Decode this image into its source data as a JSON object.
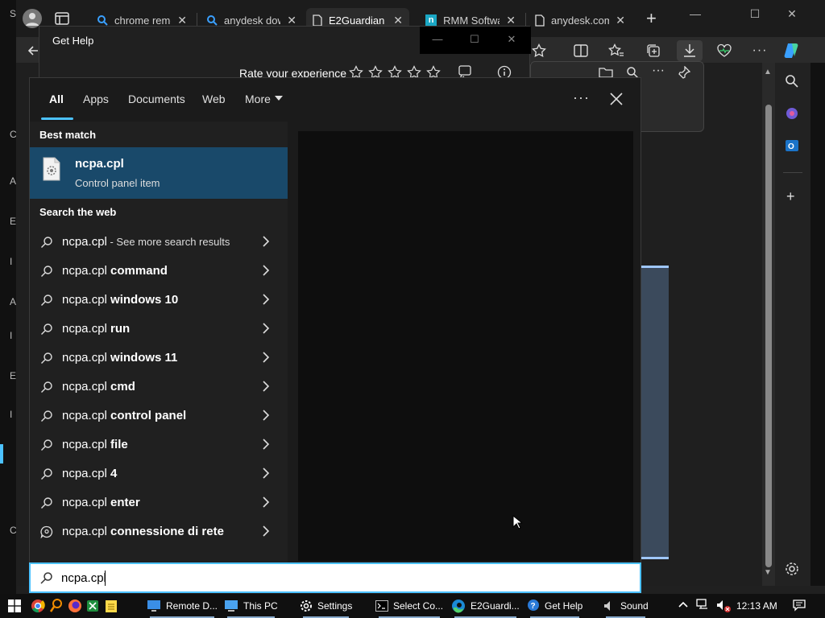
{
  "browser": {
    "tabs": [
      {
        "label": "chrome remo",
        "icon": "search-icon"
      },
      {
        "label": "anydesk dow",
        "icon": "search-icon"
      },
      {
        "label": "E2Guardian -",
        "icon": "page-icon"
      },
      {
        "label": "RMM Softwa",
        "icon": "ninja-icon"
      },
      {
        "label": "anydesk.com",
        "icon": "page-icon"
      }
    ],
    "new_tab": "+",
    "toolbar_icons": [
      "favorite-star-icon",
      "split-screen-icon",
      "favorites-icon",
      "collections-icon",
      "downloads-icon",
      "browser-essentials-icon",
      "more-icon",
      "copilot-icon"
    ]
  },
  "get_help": {
    "title": "Get Help",
    "rate_label": "Rate your experience",
    "stars": 5
  },
  "search": {
    "filters": [
      "All",
      "Apps",
      "Documents",
      "Web",
      "More"
    ],
    "best_match_header": "Best match",
    "best_match": {
      "title": "ncpa.cpl",
      "subtitle": "Control panel item"
    },
    "web_header": "Search the web",
    "web_items": [
      {
        "normal": "ncpa.cpl",
        "bold": "",
        "small": " - See more search results",
        "icon": "search-icon"
      },
      {
        "normal": "ncpa.cpl",
        "bold": " command",
        "small": "",
        "icon": "search-icon"
      },
      {
        "normal": "ncpa.cpl",
        "bold": " windows 10",
        "small": "",
        "icon": "search-icon"
      },
      {
        "normal": "ncpa.cpl",
        "bold": " run",
        "small": "",
        "icon": "search-icon"
      },
      {
        "normal": "ncpa.cpl",
        "bold": " windows 11",
        "small": "",
        "icon": "search-icon"
      },
      {
        "normal": "ncpa.cpl",
        "bold": " cmd",
        "small": "",
        "icon": "search-icon"
      },
      {
        "normal": "ncpa.cpl",
        "bold": " control panel",
        "small": "",
        "icon": "search-icon"
      },
      {
        "normal": "ncpa.cpl",
        "bold": " file",
        "small": "",
        "icon": "search-icon"
      },
      {
        "normal": "ncpa.cpl",
        "bold": " 4",
        "small": "",
        "icon": "search-icon"
      },
      {
        "normal": "ncpa.cpl",
        "bold": " enter",
        "small": "",
        "icon": "search-icon"
      },
      {
        "normal": "ncpa.cpl",
        "bold": " connessione di rete",
        "small": "",
        "icon": "chat-search-icon"
      }
    ],
    "query": "ncpa.cpl",
    "accent_color": "#4cc2ff",
    "selected_color": "#19496a"
  },
  "taskbar": {
    "apps": [
      {
        "label": "Remote D...",
        "icon": "remote-desktop-icon"
      },
      {
        "label": "This PC",
        "icon": "computer-icon"
      },
      {
        "label": "Settings",
        "icon": "settings-icon"
      },
      {
        "label": "Select Co...",
        "icon": "cmd-icon"
      },
      {
        "label": "E2Guardi...",
        "icon": "edge-icon"
      },
      {
        "label": "Get Help",
        "icon": "help-icon"
      },
      {
        "label": "Sound",
        "icon": "speaker-icon"
      }
    ],
    "clock": "12:13 AM"
  },
  "left_strip_glyphs": [
    "S",
    "C",
    "A",
    "E",
    "I",
    "A",
    "I",
    "E",
    "I",
    "C"
  ]
}
